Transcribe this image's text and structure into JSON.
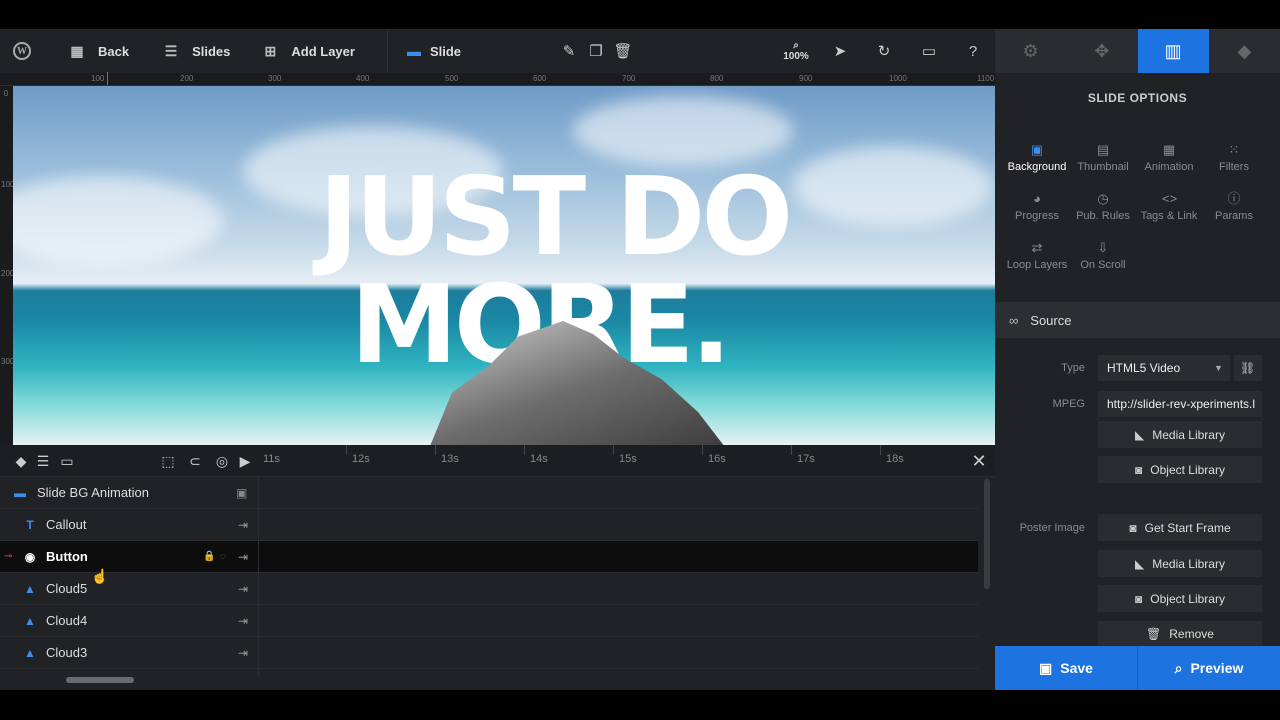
{
  "toolbar": {
    "back_label": "Back",
    "slides_label": "Slides",
    "add_layer_label": "Add Layer",
    "slide_label": "Slide",
    "zoom": "100%"
  },
  "ruler": {
    "top_marks": [
      "100",
      "200",
      "300",
      "400",
      "500",
      "600",
      "700",
      "800",
      "900",
      "1000",
      "1100"
    ],
    "left_marks": [
      "0",
      "100",
      "200",
      "300"
    ]
  },
  "canvas": {
    "headline_line1": "JUST DO",
    "headline_line2": "MORE."
  },
  "timeline": {
    "seconds": [
      "11s",
      "12s",
      "13s",
      "14s",
      "15s",
      "16s",
      "17s",
      "18s"
    ],
    "layers": [
      {
        "name": "Slide BG Animation",
        "icon": "image-icon"
      },
      {
        "name": "Callout",
        "icon": "text-icon"
      },
      {
        "name": "Button",
        "icon": "button-icon",
        "selected": true
      },
      {
        "name": "Cloud5",
        "icon": "shape-icon"
      },
      {
        "name": "Cloud4",
        "icon": "shape-icon"
      },
      {
        "name": "Cloud3",
        "icon": "shape-icon"
      }
    ]
  },
  "panel": {
    "title": "SLIDE OPTIONS",
    "tabs": [
      {
        "label": "Background",
        "icon": "image-icon",
        "active": true
      },
      {
        "label": "Thumbnail",
        "icon": "thumbnail-icon"
      },
      {
        "label": "Animation",
        "icon": "film-icon"
      },
      {
        "label": "Filters",
        "icon": "grid-icon"
      },
      {
        "label": "Progress",
        "icon": "stopwatch-icon"
      },
      {
        "label": "Pub. Rules",
        "icon": "clock-icon"
      },
      {
        "label": "Tags & Link",
        "icon": "code-icon"
      },
      {
        "label": "Params",
        "icon": "info-icon"
      },
      {
        "label": "Loop Layers",
        "icon": "loop-icon"
      },
      {
        "label": "On Scroll",
        "icon": "scroll-icon"
      }
    ],
    "source_label": "Source",
    "type_label": "Type",
    "type_value": "HTML5 Video",
    "mpeg_label": "MPEG",
    "mpeg_value": "http://slider-rev-xperiments.l",
    "media_library_label": "Media Library",
    "object_library_label": "Object Library",
    "poster_label": "Poster Image",
    "get_start_frame_label": "Get Start Frame",
    "remove_label": "Remove"
  },
  "footer": {
    "save_label": "Save",
    "preview_label": "Preview"
  },
  "colors": {
    "accent": "#1d73e0",
    "dark_bg": "#212225"
  }
}
